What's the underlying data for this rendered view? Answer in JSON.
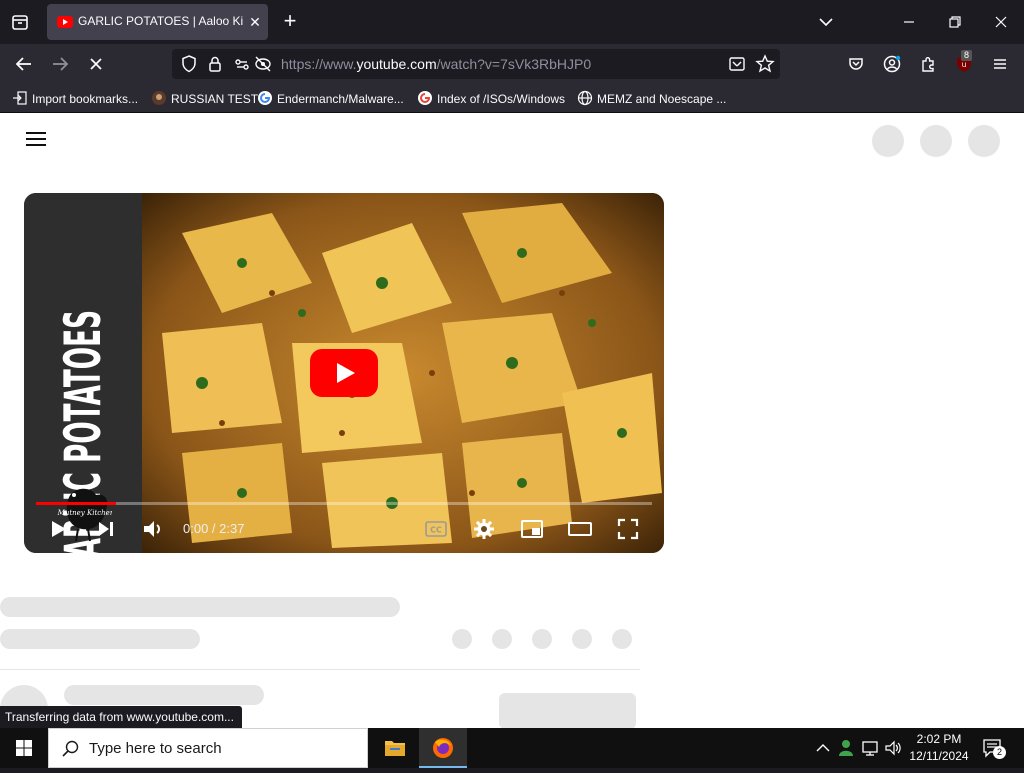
{
  "browser": {
    "tab": {
      "title": "GARLIC POTATOES | Aaloo Ki Bu"
    },
    "url": {
      "scheme": "https://www.",
      "host": "youtube.com",
      "path": "/watch?v=7sVk3RbHJP0"
    },
    "extension_badge": "8",
    "bookmarks": [
      {
        "label": "Import bookmarks...",
        "icon": "import-icon"
      },
      {
        "label": "RUSSIAN TEST",
        "icon": "site-favicon"
      },
      {
        "label": "Endermanch/Malware...",
        "icon": "google-icon"
      },
      {
        "label": "Index of /ISOs/Windows",
        "icon": "google-icon"
      },
      {
        "label": "MEMZ and Noescape ...",
        "icon": "globe-icon"
      }
    ]
  },
  "player": {
    "thumbnail_text": "GARLIC POTATOES",
    "watermark_text": "Mutney Kitchen",
    "time": "0:00 / 2:37",
    "cc_label": "CC",
    "progress": 0.13
  },
  "status_tip": "Transferring data from www.youtube.com...",
  "taskbar": {
    "search_placeholder": "Type here to search",
    "clock_time": "2:02 PM",
    "clock_date": "12/11/2024",
    "notification_count": "2"
  },
  "colors": {
    "accent": "#ff0000",
    "chrome_dark": "#1c1b22",
    "toolbar": "#2b2a33",
    "skeleton": "#e5e5e5"
  }
}
